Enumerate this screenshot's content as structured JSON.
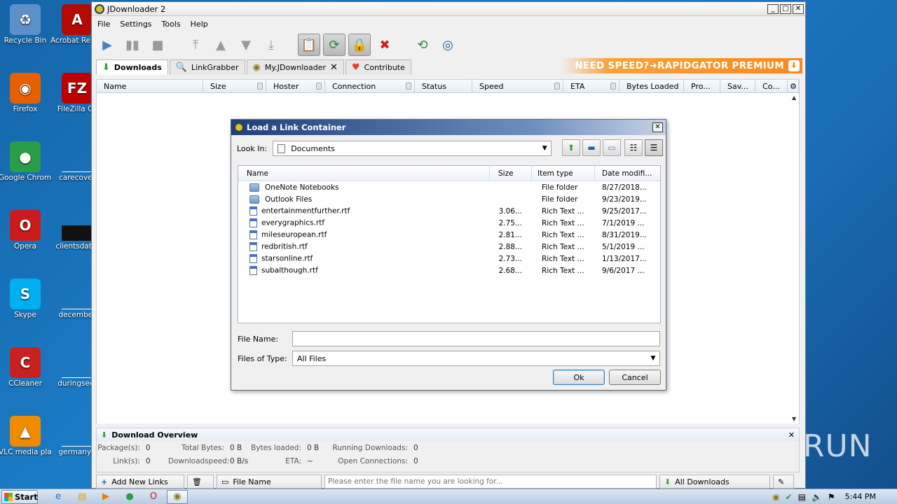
{
  "desktop": {
    "icons_left": [
      {
        "label": "Recycle Bin",
        "icon": "recycle-bin-icon",
        "color": "#5d8fc8",
        "glyph": "♻"
      },
      {
        "label": "Firefox",
        "icon": "firefox-icon",
        "color": "#e66000",
        "glyph": "◉"
      },
      {
        "label": "Google Chrome",
        "icon": "chrome-icon",
        "color": "#2a9d48",
        "glyph": "●"
      },
      {
        "label": "Opera",
        "icon": "opera-icon",
        "color": "#cc1b1b",
        "glyph": "O"
      },
      {
        "label": "Skype",
        "icon": "skype-icon",
        "color": "#00aff0",
        "glyph": "S"
      },
      {
        "label": "CCleaner",
        "icon": "ccleaner-icon",
        "color": "#c92020",
        "glyph": "C"
      },
      {
        "label": "VLC media player",
        "icon": "vlc-icon",
        "color": "#f08a00",
        "glyph": "▲"
      }
    ],
    "icons_right": [
      {
        "label": "Acrobat Reader DC",
        "icon": "acrobat-icon",
        "color": "#b30b00",
        "glyph": "A"
      },
      {
        "label": "FileZilla Cli",
        "icon": "filezilla-icon",
        "color": "#bf0000",
        "glyph": "FZ"
      },
      {
        "label": "carecover",
        "icon": "document-icon",
        "color": "#ffffff",
        "glyph": ""
      },
      {
        "label": "clientsdatin",
        "icon": "document-icon",
        "color": "#111111",
        "glyph": ""
      },
      {
        "label": "december",
        "icon": "document-icon",
        "color": "#ffffff",
        "glyph": ""
      },
      {
        "label": "duringsee.",
        "icon": "document-icon",
        "color": "#ffffff",
        "glyph": ""
      },
      {
        "label": "germanyo",
        "icon": "document-icon",
        "color": "#ffffff",
        "glyph": ""
      }
    ]
  },
  "app": {
    "title": "JDownloader 2",
    "menu": [
      "File",
      "Settings",
      "Tools",
      "Help"
    ],
    "tabs": [
      {
        "label": "Downloads",
        "icon": "download-arrow-icon",
        "active": true
      },
      {
        "label": "LinkGrabber",
        "icon": "linkgrabber-icon",
        "active": false
      },
      {
        "label": "My.JDownloader",
        "icon": "myjd-icon",
        "active": false,
        "closable": true
      },
      {
        "label": "Contribute",
        "icon": "heart-icon",
        "active": false
      }
    ],
    "banner": "NEED SPEED?➜RAPIDGATOR PREMIUM",
    "columns": [
      "Name",
      "Size",
      "Hoster",
      "Connection",
      "Status",
      "Speed",
      "ETA",
      "Bytes Loaded",
      "Pro...",
      "Sav...",
      "Co..."
    ],
    "overview": {
      "title": "Download Overview",
      "packages_label": "Package(s):",
      "packages": "0",
      "total_bytes_label": "Total Bytes:",
      "total_bytes": "0 B",
      "bytes_loaded_label": "Bytes loaded:",
      "bytes_loaded": "0 B",
      "running_label": "Running Downloads:",
      "running": "0",
      "links_label": "Link(s):",
      "links": "0",
      "speed_label": "Downloadspeed:",
      "speed": "0 B/s",
      "eta_label": "ETA:",
      "eta": "~",
      "open_conn_label": "Open Connections:",
      "open_conn": "0"
    },
    "bottom": {
      "add_links": "Add New Links",
      "file_name_filter": "File Name",
      "search_placeholder": "Please enter the file name you are looking for...",
      "all_downloads": "All Downloads"
    }
  },
  "dialog": {
    "title": "Load a Link Container",
    "look_in_label": "Look In:",
    "look_in_value": "Documents",
    "columns": [
      "Name",
      "Size",
      "Item type",
      "Date modifi..."
    ],
    "files": [
      {
        "name": "OneNote Notebooks",
        "size": "",
        "type": "File folder",
        "date": "8/27/2018...",
        "kind": "folder"
      },
      {
        "name": "Outlook Files",
        "size": "",
        "type": "File folder",
        "date": "9/23/2019...",
        "kind": "folder"
      },
      {
        "name": "entertainmentfurther.rtf",
        "size": "3.06...",
        "type": "Rich Text ...",
        "date": "9/25/2017...",
        "kind": "rtf"
      },
      {
        "name": "everygraphics.rtf",
        "size": "2.75...",
        "type": "Rich Text ...",
        "date": "7/1/2019 ...",
        "kind": "rtf"
      },
      {
        "name": "mileseuropean.rtf",
        "size": "2.81...",
        "type": "Rich Text ...",
        "date": "8/31/2019...",
        "kind": "rtf"
      },
      {
        "name": "redbritish.rtf",
        "size": "2.88...",
        "type": "Rich Text ...",
        "date": "5/1/2019 ...",
        "kind": "rtf"
      },
      {
        "name": "starsonline.rtf",
        "size": "2.73...",
        "type": "Rich Text ...",
        "date": "1/13/2017...",
        "kind": "rtf"
      },
      {
        "name": "subalthough.rtf",
        "size": "2.68...",
        "type": "Rich Text ...",
        "date": "9/6/2017 ...",
        "kind": "rtf"
      }
    ],
    "file_name_label": "File Name:",
    "file_name_value": "",
    "files_of_type_label": "Files of Type:",
    "files_of_type_value": "All Files",
    "ok": "Ok",
    "cancel": "Cancel"
  },
  "taskbar": {
    "start": "Start",
    "clock": "5:44 PM"
  },
  "watermark": "ANY RUN"
}
